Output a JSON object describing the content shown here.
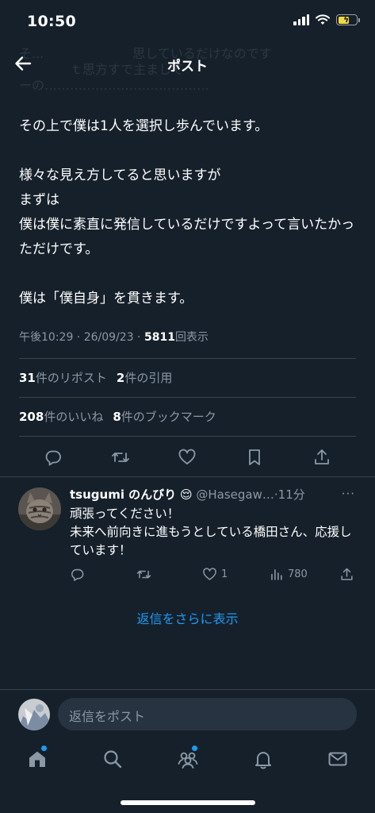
{
  "status_bar": {
    "time": "10:50"
  },
  "header": {
    "title": "ポスト"
  },
  "ghost_text": "そ...　　　　　　　思しているだけなのです\n　　　　ｔ思方すで主まして\nーの…………………………………",
  "post": {
    "paragraphs": [
      "その上で僕は1人を選択し歩んでいます。",
      "",
      "様々な見え方してると思いますが",
      "まずは",
      "僕は僕に素直に発信しているだけですよって言いたかっただけです。",
      "",
      "僕は「僕自身」を貫きます。"
    ],
    "meta": {
      "time": "午後10:29",
      "sep": " · ",
      "date": "26/09/23",
      "views_count": "5811",
      "views_label": "回表示"
    }
  },
  "stats": {
    "reposts": {
      "count": "31",
      "label": "件のリポスト"
    },
    "quotes": {
      "count": "2",
      "label": "件の引用"
    },
    "likes": {
      "count": "208",
      "label": "件のいいね"
    },
    "bookmarks": {
      "count": "8",
      "label": "件のブックマーク"
    }
  },
  "actions": [
    "reply-icon",
    "repost-icon",
    "like-icon",
    "bookmark-icon",
    "share-icon"
  ],
  "reply": {
    "name": "tsugumi のんびり",
    "emoji": "😌",
    "handle": "@Hasegaw…",
    "time": "11分",
    "more": "···",
    "lines": [
      "頑張ってください！",
      "未来へ前向きに進もうとしている橋田さん、応援しています！"
    ],
    "likes": "1",
    "views": "780"
  },
  "show_more_replies": "返信をさらに表示",
  "compose": {
    "placeholder": "返信をポスト"
  },
  "tabs": [
    "home-icon",
    "search-icon",
    "communities-icon",
    "notifications-icon",
    "messages-icon"
  ],
  "colors": {
    "background": "#15202b",
    "accent": "#1d9bf0",
    "muted": "#8b98a5",
    "divider": "#38444d",
    "battery": "#f4d93b"
  }
}
